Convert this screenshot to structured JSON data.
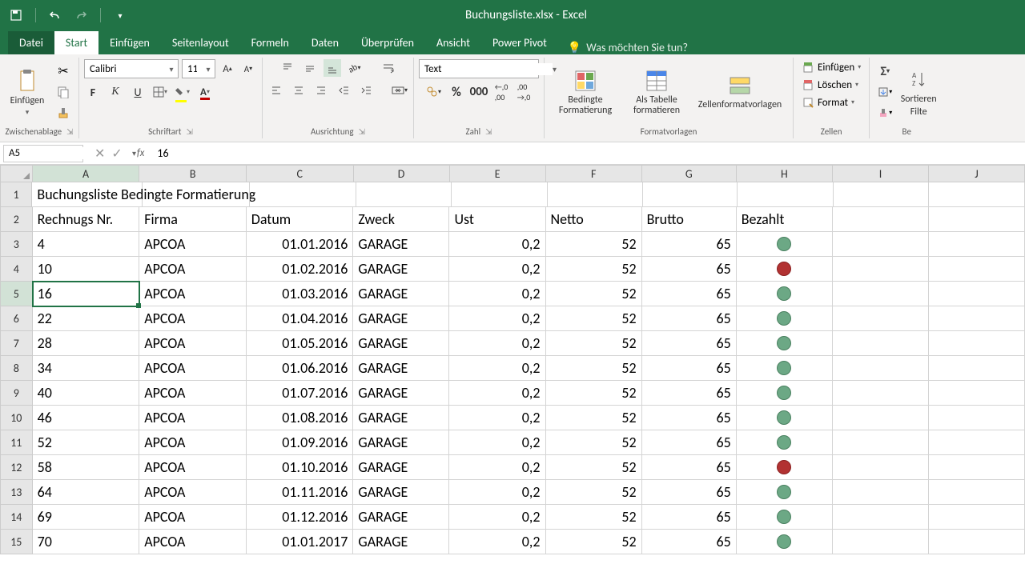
{
  "app": {
    "title": "Buchungsliste.xlsx - Excel"
  },
  "tabs": {
    "file": "Datei",
    "home": "Start",
    "insert": "Einfügen",
    "pagelayout": "Seitenlayout",
    "formulas": "Formeln",
    "data": "Daten",
    "review": "Überprüfen",
    "view": "Ansicht",
    "powerpivot": "Power Pivot",
    "tellme": "Was möchten Sie tun?"
  },
  "ribbon": {
    "clipboard": {
      "paste": "Einfügen",
      "label": "Zwischenablage"
    },
    "font": {
      "name": "Calibri",
      "size": "11",
      "label": "Schriftart"
    },
    "alignment": {
      "label": "Ausrichtung"
    },
    "number": {
      "format": "Text",
      "label": "Zahl"
    },
    "styles": {
      "cond": "Bedingte Formatierung",
      "table": "Als Tabelle formatieren",
      "cell": "Zellenformatvorlagen",
      "label": "Formatvorlagen"
    },
    "cells": {
      "insert": "Einfügen",
      "delete": "Löschen",
      "format": "Format",
      "label": "Zellen"
    },
    "editing": {
      "sort": "Sortieren",
      "filter": "Filte",
      "label": "Be"
    }
  },
  "namebox": {
    "value": "A5"
  },
  "formula": {
    "value": "16"
  },
  "columns": [
    "A",
    "B",
    "C",
    "D",
    "E",
    "F",
    "G",
    "H",
    "I",
    "J"
  ],
  "sheet": {
    "title": "Buchungsliste Bedingte Formatierung",
    "headers": [
      "Rechnugs Nr.",
      "Firma",
      "Datum",
      "Zweck",
      "Ust",
      "Netto",
      "Brutto",
      "Bezahlt"
    ],
    "rows": [
      {
        "n": "4",
        "f": "APCOA",
        "d": "01.01.2016",
        "z": "GARAGE",
        "u": "0,2",
        "ne": "52",
        "b": "65",
        "p": "green"
      },
      {
        "n": "10",
        "f": "APCOA",
        "d": "01.02.2016",
        "z": "GARAGE",
        "u": "0,2",
        "ne": "52",
        "b": "65",
        "p": "red"
      },
      {
        "n": "16",
        "f": "APCOA",
        "d": "01.03.2016",
        "z": "GARAGE",
        "u": "0,2",
        "ne": "52",
        "b": "65",
        "p": "green"
      },
      {
        "n": "22",
        "f": "APCOA",
        "d": "01.04.2016",
        "z": "GARAGE",
        "u": "0,2",
        "ne": "52",
        "b": "65",
        "p": "green"
      },
      {
        "n": "28",
        "f": "APCOA",
        "d": "01.05.2016",
        "z": "GARAGE",
        "u": "0,2",
        "ne": "52",
        "b": "65",
        "p": "green"
      },
      {
        "n": "34",
        "f": "APCOA",
        "d": "01.06.2016",
        "z": "GARAGE",
        "u": "0,2",
        "ne": "52",
        "b": "65",
        "p": "green"
      },
      {
        "n": "40",
        "f": "APCOA",
        "d": "01.07.2016",
        "z": "GARAGE",
        "u": "0,2",
        "ne": "52",
        "b": "65",
        "p": "green"
      },
      {
        "n": "46",
        "f": "APCOA",
        "d": "01.08.2016",
        "z": "GARAGE",
        "u": "0,2",
        "ne": "52",
        "b": "65",
        "p": "green"
      },
      {
        "n": "52",
        "f": "APCOA",
        "d": "01.09.2016",
        "z": "GARAGE",
        "u": "0,2",
        "ne": "52",
        "b": "65",
        "p": "green"
      },
      {
        "n": "58",
        "f": "APCOA",
        "d": "01.10.2016",
        "z": "GARAGE",
        "u": "0,2",
        "ne": "52",
        "b": "65",
        "p": "red"
      },
      {
        "n": "64",
        "f": "APCOA",
        "d": "01.11.2016",
        "z": "GARAGE",
        "u": "0,2",
        "ne": "52",
        "b": "65",
        "p": "green"
      },
      {
        "n": "69",
        "f": "APCOA",
        "d": "01.12.2016",
        "z": "GARAGE",
        "u": "0,2",
        "ne": "52",
        "b": "65",
        "p": "green"
      },
      {
        "n": "70",
        "f": "APCOA",
        "d": "01.01.2017",
        "z": "GARAGE",
        "u": "0,2",
        "ne": "52",
        "b": "65",
        "p": "green"
      }
    ]
  }
}
